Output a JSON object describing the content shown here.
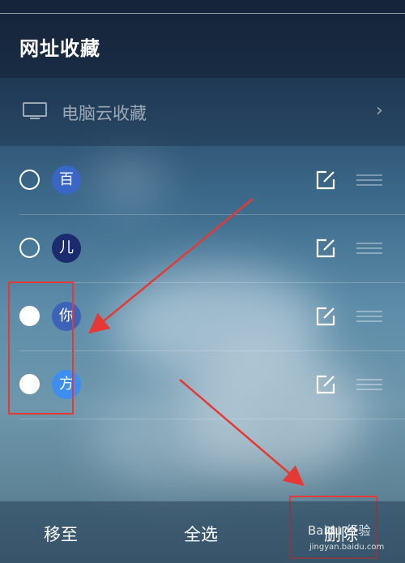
{
  "header": {
    "title": "网址收藏"
  },
  "cloud": {
    "label": "电脑云收藏",
    "chevron": "›",
    "icon": "monitor-icon"
  },
  "rows": [
    {
      "avatar_char": "百",
      "avatar_color": "#3a67c4",
      "selected": false
    },
    {
      "avatar_char": "儿",
      "avatar_color": "#1b2b6e",
      "selected": false
    },
    {
      "avatar_char": "你",
      "avatar_color": "#3d63b8",
      "selected": true
    },
    {
      "avatar_char": "方",
      "avatar_color": "#3d8ef0",
      "selected": true
    }
  ],
  "bottom": {
    "move_label": "移至",
    "select_all_label": "全选",
    "delete_label": "删除"
  },
  "watermark": {
    "text": "Baidu 经验",
    "url": "jingyan.baidu.com"
  },
  "colors": {
    "annotation_red": "#e53935"
  }
}
